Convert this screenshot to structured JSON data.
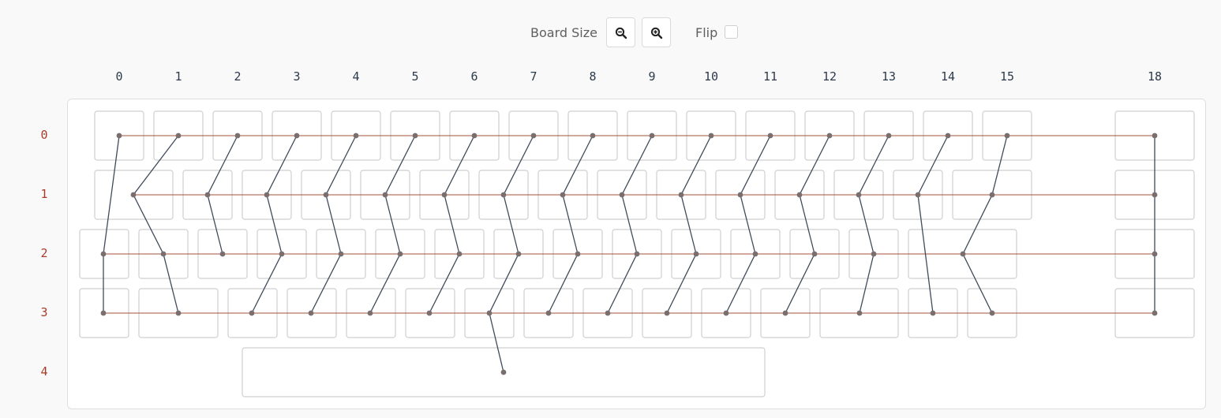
{
  "toolbar": {
    "board_size_label": "Board Size",
    "zoom_out_icon": "zoom-out-icon",
    "zoom_in_icon": "zoom-in-icon",
    "flip_label": "Flip",
    "flip_checked": false
  },
  "columns": [
    "0",
    "1",
    "2",
    "3",
    "4",
    "5",
    "6",
    "7",
    "8",
    "9",
    "10",
    "11",
    "12",
    "13",
    "14",
    "15",
    "18"
  ],
  "rows": [
    "0",
    "1",
    "2",
    "3",
    "4"
  ],
  "colors": {
    "row_wire": "#a0523a",
    "col_wire": "#3f4b5c",
    "node": "#7a6e6e",
    "key_border": "#cfcfcf"
  }
}
